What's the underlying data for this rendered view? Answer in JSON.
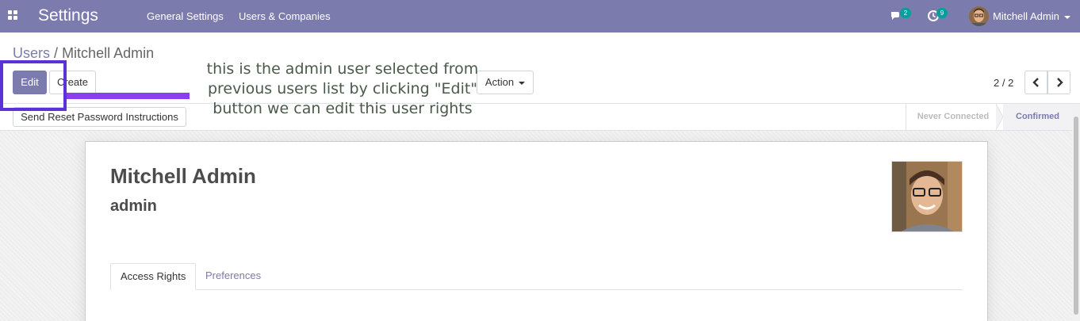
{
  "topbar": {
    "app_title": "Settings",
    "menu": [
      "General Settings",
      "Users & Companies"
    ],
    "messages_badge": "2",
    "activities_badge": "9",
    "user_name": "Mitchell Admin",
    "icons": [
      "apps-icon",
      "chat-icon",
      "clock-icon",
      "avatar"
    ]
  },
  "breadcrumb": {
    "parent": "Users",
    "separator": "/",
    "current": "Mitchell Admin"
  },
  "buttons": {
    "edit": "Edit",
    "create": "Create",
    "action": "Action",
    "send_reset": "Send Reset Password Instructions"
  },
  "pager": {
    "value": "2 / 2"
  },
  "annotation": {
    "lines": [
      "this is the admin user selected from",
      "previous users list by clicking \"Edit\"",
      "button we can edit this user rights"
    ]
  },
  "status_stages": [
    {
      "label": "Never Connected",
      "active": false
    },
    {
      "label": "Confirmed",
      "active": true
    }
  ],
  "sheet": {
    "name": "Mitchell Admin",
    "login": "admin",
    "tabs": [
      {
        "label": "Access Rights",
        "active": true
      },
      {
        "label": "Preferences",
        "active": false
      }
    ]
  },
  "colors": {
    "brand": "#7c7bad",
    "badge": "#00a09d",
    "annotation_box": "#5a32d8",
    "annotation_line": "#8a3ef0"
  }
}
